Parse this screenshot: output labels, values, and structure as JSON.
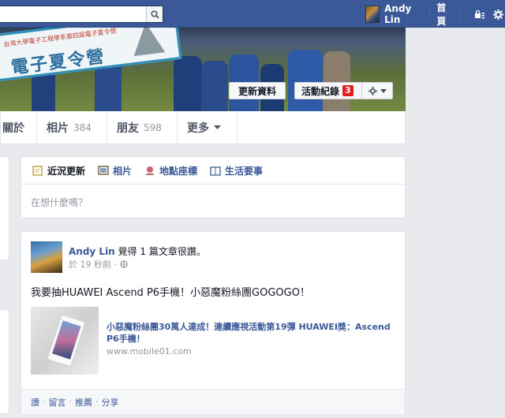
{
  "topbar": {
    "search_placeholder": "",
    "user_name": "Andy Lin",
    "home_label": "首頁",
    "brand_color": "#3b5998"
  },
  "cover": {
    "banner_text": "電子夏令營",
    "banner_small_text": "台灣大學電子工程學系第四屆電子夏令營",
    "update_info_label": "更新資料",
    "activity_log_label": "活動紀錄",
    "activity_badge": "3"
  },
  "tabs": [
    {
      "label": "關於",
      "count": ""
    },
    {
      "label": "相片",
      "count": "384"
    },
    {
      "label": "朋友",
      "count": "598"
    },
    {
      "label": "更多",
      "count": ""
    }
  ],
  "composer": {
    "tabs": [
      {
        "label": "近況更新",
        "icon": "status-icon"
      },
      {
        "label": "相片",
        "icon": "photo-icon"
      },
      {
        "label": "地點座標",
        "icon": "place-icon"
      },
      {
        "label": "生活要事",
        "icon": "life-event-icon"
      }
    ],
    "placeholder": "在想什麼嗎？"
  },
  "post": {
    "author": "Andy Lin",
    "action": " 覺得 1 篇文章很讚。",
    "time": "於 19 秒前 ·",
    "text": "我要抽HUAWEI Ascend P6手機！小惡魔粉絲團GOGOGO！",
    "link_title": "小惡魔粉絲團30萬人達成！連續應視活動第19彈 HUAWEI獎：Ascend P6手機！",
    "link_domain": "www.mobile01.com",
    "actions": [
      "讚",
      "留言",
      "推薦",
      "分享"
    ]
  }
}
